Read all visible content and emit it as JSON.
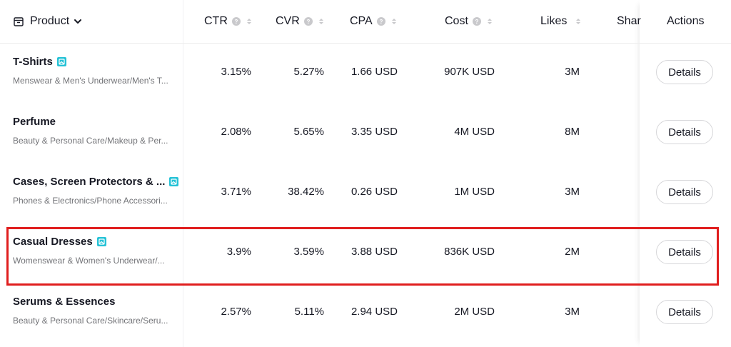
{
  "header": {
    "product_label": "Product",
    "ctr_label": "CTR",
    "cvr_label": "CVR",
    "cpa_label": "CPA",
    "cost_label": "Cost",
    "likes_label": "Likes",
    "share_label": "Shar",
    "actions_label": "Actions"
  },
  "rows": [
    {
      "name": "T-Shirts",
      "category": "Menswear & Men's Underwear/Men's T...",
      "ctr": "3.15%",
      "cvr": "5.27%",
      "cpa": "1.66 USD",
      "cost": "907K USD",
      "likes": "3M",
      "action": "Details",
      "badge": true
    },
    {
      "name": "Perfume",
      "category": "Beauty & Personal Care/Makeup & Per...",
      "ctr": "2.08%",
      "cvr": "5.65%",
      "cpa": "3.35 USD",
      "cost": "4M USD",
      "likes": "8M",
      "action": "Details",
      "badge": false
    },
    {
      "name": "Cases, Screen Protectors & ...",
      "category": "Phones & Electronics/Phone Accessori...",
      "ctr": "3.71%",
      "cvr": "38.42%",
      "cpa": "0.26 USD",
      "cost": "1M USD",
      "likes": "3M",
      "action": "Details",
      "badge": true
    },
    {
      "name": "Casual Dresses",
      "category": "Womenswear & Women's Underwear/...",
      "ctr": "3.9%",
      "cvr": "3.59%",
      "cpa": "3.88 USD",
      "cost": "836K USD",
      "likes": "2M",
      "action": "Details",
      "badge": true
    },
    {
      "name": "Serums & Essences",
      "category": "Beauty & Personal Care/Skincare/Seru...",
      "ctr": "2.57%",
      "cvr": "5.11%",
      "cpa": "2.94 USD",
      "cost": "2M USD",
      "likes": "3M",
      "action": "Details",
      "badge": false
    }
  ],
  "colors": {
    "highlight": "#e01e1e",
    "badge": "#25c2d6",
    "text": "#161823",
    "subtext": "#737478"
  }
}
